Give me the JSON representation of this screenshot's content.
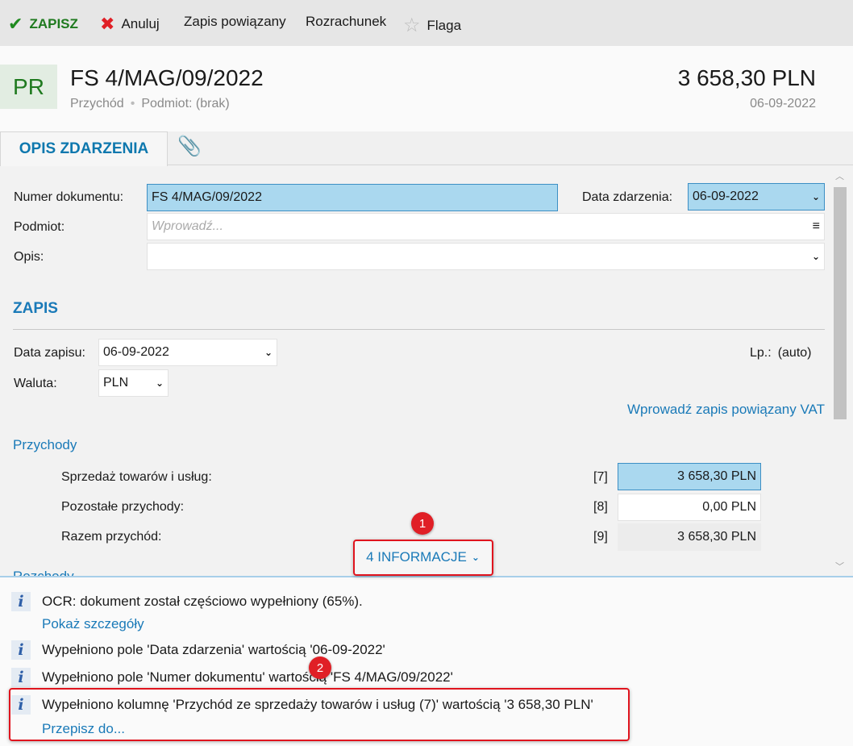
{
  "toolbar": {
    "save": "ZAPISZ",
    "cancel": "Anuluj",
    "linked": "Zapis powiązany",
    "settlement": "Rozrachunek",
    "flag": "Flaga"
  },
  "header": {
    "badge": "PR",
    "title": "FS 4/MAG/09/2022",
    "type": "Przychód",
    "separator": "•",
    "subject": "Podmiot: (brak)",
    "amount": "3 658,30 PLN",
    "date": "06-09-2022"
  },
  "tabs": {
    "active": "OPIS ZDARZENIA"
  },
  "form": {
    "doc_number_label": "Numer dokumentu:",
    "doc_number": "FS 4/MAG/09/2022",
    "event_date_label": "Data zdarzenia:",
    "event_date": "06-09-2022",
    "subject_label": "Podmiot:",
    "subject_placeholder": "Wprowadź...",
    "desc_label": "Opis:",
    "desc": ""
  },
  "zapis": {
    "heading": "ZAPIS",
    "date_label": "Data zapisu:",
    "date": "06-09-2022",
    "currency_label": "Waluta:",
    "currency": "PLN",
    "lp_label": "Lp.:",
    "lp": "(auto)",
    "vat_link": "Wprowadź zapis powiązany VAT",
    "income_heading": "Przychody",
    "hidden_heading": "Rozchody",
    "rows": [
      {
        "label": "Sprzedaż towarów i usług:",
        "col": "[7]",
        "value": "3 658,30 PLN"
      },
      {
        "label": "Pozostałe przychody:",
        "col": "[8]",
        "value": "0,00 PLN"
      },
      {
        "label": "Razem przychód:",
        "col": "[9]",
        "value": "3 658,30 PLN"
      }
    ]
  },
  "info_toggle": "4 INFORMACJE",
  "badges": [
    "1",
    "2"
  ],
  "info": [
    {
      "text": "OCR: dokument został częściowo wypełniony (65%).",
      "link": "Pokaż szczegóły"
    },
    {
      "text": "Wypełniono pole 'Data zdarzenia' wartością '06-09-2022'"
    },
    {
      "text": "Wypełniono pole 'Numer dokumentu' wartością 'FS 4/MAG/09/2022'"
    },
    {
      "text": "Wypełniono kolumnę 'Przychód ze sprzedaży towarów i usług (7)' wartością '3 658,30 PLN'",
      "link": "Przepisz do..."
    }
  ],
  "colors": {
    "accent": "#1a7ab8",
    "save": "#1f8a1f",
    "highlight": "#aad8ef",
    "annotation": "#e0141e"
  }
}
